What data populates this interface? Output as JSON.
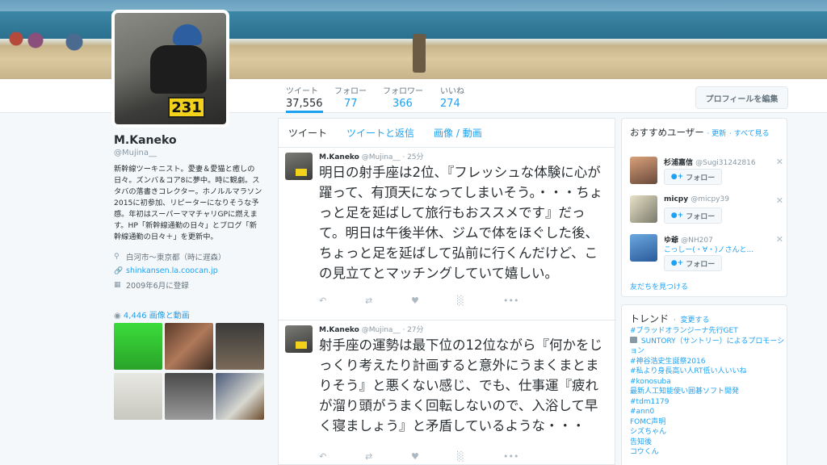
{
  "nav": {
    "stats": [
      {
        "label": "ツイート",
        "value": "37,556"
      },
      {
        "label": "フォロー",
        "value": "77"
      },
      {
        "label": "フォロワー",
        "value": "366"
      },
      {
        "label": "いいね",
        "value": "274"
      }
    ],
    "edit_profile": "プロフィールを編集"
  },
  "avatar": {
    "plate": "231"
  },
  "profile": {
    "name": "M.Kaneko",
    "handle": "@Mujina__",
    "bio": "新幹線ツーキニスト。愛妻＆愛猫と癒しの日々。ズンバ＆コア8に夢中。時に観劇。スタバの落書きコレクター。ホノルルマラソン2015に初参加、リピーターになりそうな予感。年初はスーパーママチャリGPに燃えます。HP「新幹線通勤の日々」とブログ「新幹線通勤の日々＋」を更新中。",
    "location": "白河市〜東京都（時に遅森）",
    "url": "shinkansen.la.coocan.jp",
    "joined": "2009年6月に登録",
    "media_link": "4,446 画像と動画"
  },
  "timeline": {
    "tabs": [
      "ツイート",
      "ツイートと返信",
      "画像 / 動画"
    ],
    "tweets": [
      {
        "name": "M.Kaneko",
        "handle": "@Mujina__",
        "time": "25分",
        "text": "明日の射手座は2位、『フレッシュな体験に心が躍って、有頂天になってしまいそう。・・・ちょっと足を延ばして旅行もおススメです』だって。明日は午後半休、ジムで体をほぐした後、ちょっと足を延ばして弘前に行くんだけど、この見立てとマッチングしていて嬉しい。"
      },
      {
        "name": "M.Kaneko",
        "handle": "@Mujina__",
        "time": "27分",
        "text": "射手座の運勢は最下位の12位ながら『何かをじっくり考えたり計画すると意外にうまくまとまりそう』と悪くない感じ、でも、仕事運『疲れが溜り頭がうまく回転しないので、入浴して早く寝ましょう』と矛盾しているような・・・"
      }
    ]
  },
  "who_to_follow": {
    "title": "おすすめユーザー",
    "refresh": "更新",
    "view_all": "すべて見る",
    "follow_label": "フォロー",
    "users": [
      {
        "name": "杉浦嘉信",
        "handle": "@Sugi31242816",
        "note": ""
      },
      {
        "name": "micpy",
        "handle": "@micpy39",
        "note": ""
      },
      {
        "name": "ゆ爺",
        "handle": "@NH207",
        "note": "こっしー(・∀・)ノさんと..."
      }
    ],
    "find_friends": "友だちを見つける"
  },
  "trends": {
    "title": "トレンド",
    "change": "変更する",
    "items": [
      "#ブラッドオランジーナ先行GET",
      "SUNTORY（サントリー）によるプロモーション",
      "#神谷浩史生誕祭2016",
      "#私より身長高い人RT低い人いいね",
      "#konosuba",
      "最新人工知能使い囲碁ソフト開発",
      "#tdm1179",
      "#ann0",
      "FOMC声明",
      "シズちゃん",
      "告知後",
      "コウくん"
    ]
  },
  "icons": {
    "reply": "reply-icon",
    "retweet": "retweet-icon",
    "like": "heart-icon",
    "analytics": "analytics-icon",
    "more": "more-icon",
    "location": "location-icon",
    "link": "link-icon",
    "calendar": "calendar-icon",
    "camera": "camera-icon",
    "close": "close-icon"
  }
}
